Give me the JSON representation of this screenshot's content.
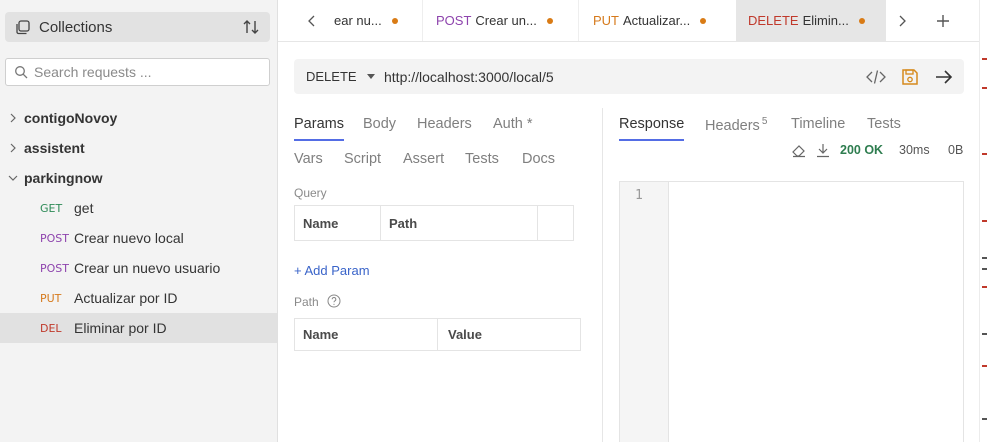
{
  "sidebar": {
    "collections_label": "Collections",
    "search_placeholder": "Search requests ...",
    "collections": [
      {
        "name": "contigoNovoy",
        "expanded": false
      },
      {
        "name": "assistent",
        "expanded": false
      },
      {
        "name": "parkingnow",
        "expanded": true
      }
    ],
    "requests": [
      {
        "method": "GET",
        "name": "get",
        "color": "#2e8b57"
      },
      {
        "method": "POST",
        "name": "Crear nuevo local",
        "color": "#8e44ad"
      },
      {
        "method": "POST",
        "name": "Crear un nuevo usuario",
        "color": "#8e44ad"
      },
      {
        "method": "PUT",
        "name": "Actualizar por ID",
        "color": "#d67a1c"
      },
      {
        "method": "DEL",
        "name": "Eliminar por ID",
        "color": "#c0392b",
        "active": true
      }
    ]
  },
  "tabs": [
    {
      "method": "",
      "title": "ear nu...",
      "color": "#343434"
    },
    {
      "method": "POST",
      "title": "Crear un...",
      "color": "#8e44ad"
    },
    {
      "method": "PUT",
      "title": "Actualizar...",
      "color": "#d67a1c"
    },
    {
      "method": "DELETE",
      "title": "Elimin...",
      "color": "#c0392b",
      "active": true
    }
  ],
  "request": {
    "method": "DELETE",
    "url": "http://localhost:3000/local/5",
    "tabs_row1": [
      "Params",
      "Body",
      "Headers",
      "Auth *"
    ],
    "tabs_row2": [
      "Vars",
      "Script",
      "Assert",
      "Tests",
      "Docs"
    ],
    "query_label": "Query",
    "query_headers": [
      "Name",
      "Path"
    ],
    "add_param": "+ Add Param",
    "path_label": "Path",
    "path_headers": [
      "Name",
      "Value"
    ]
  },
  "response": {
    "tabs": [
      "Response",
      "Headers",
      "Timeline",
      "Tests"
    ],
    "headers_count": "5",
    "status": "200 OK",
    "time": "30ms",
    "size": "0B",
    "line_number": "1"
  },
  "colors": {
    "accent": "#546de5",
    "status_ok": "#2e7d4f",
    "modified_dot": "#d97b15",
    "save_icon": "#d68a1c"
  }
}
